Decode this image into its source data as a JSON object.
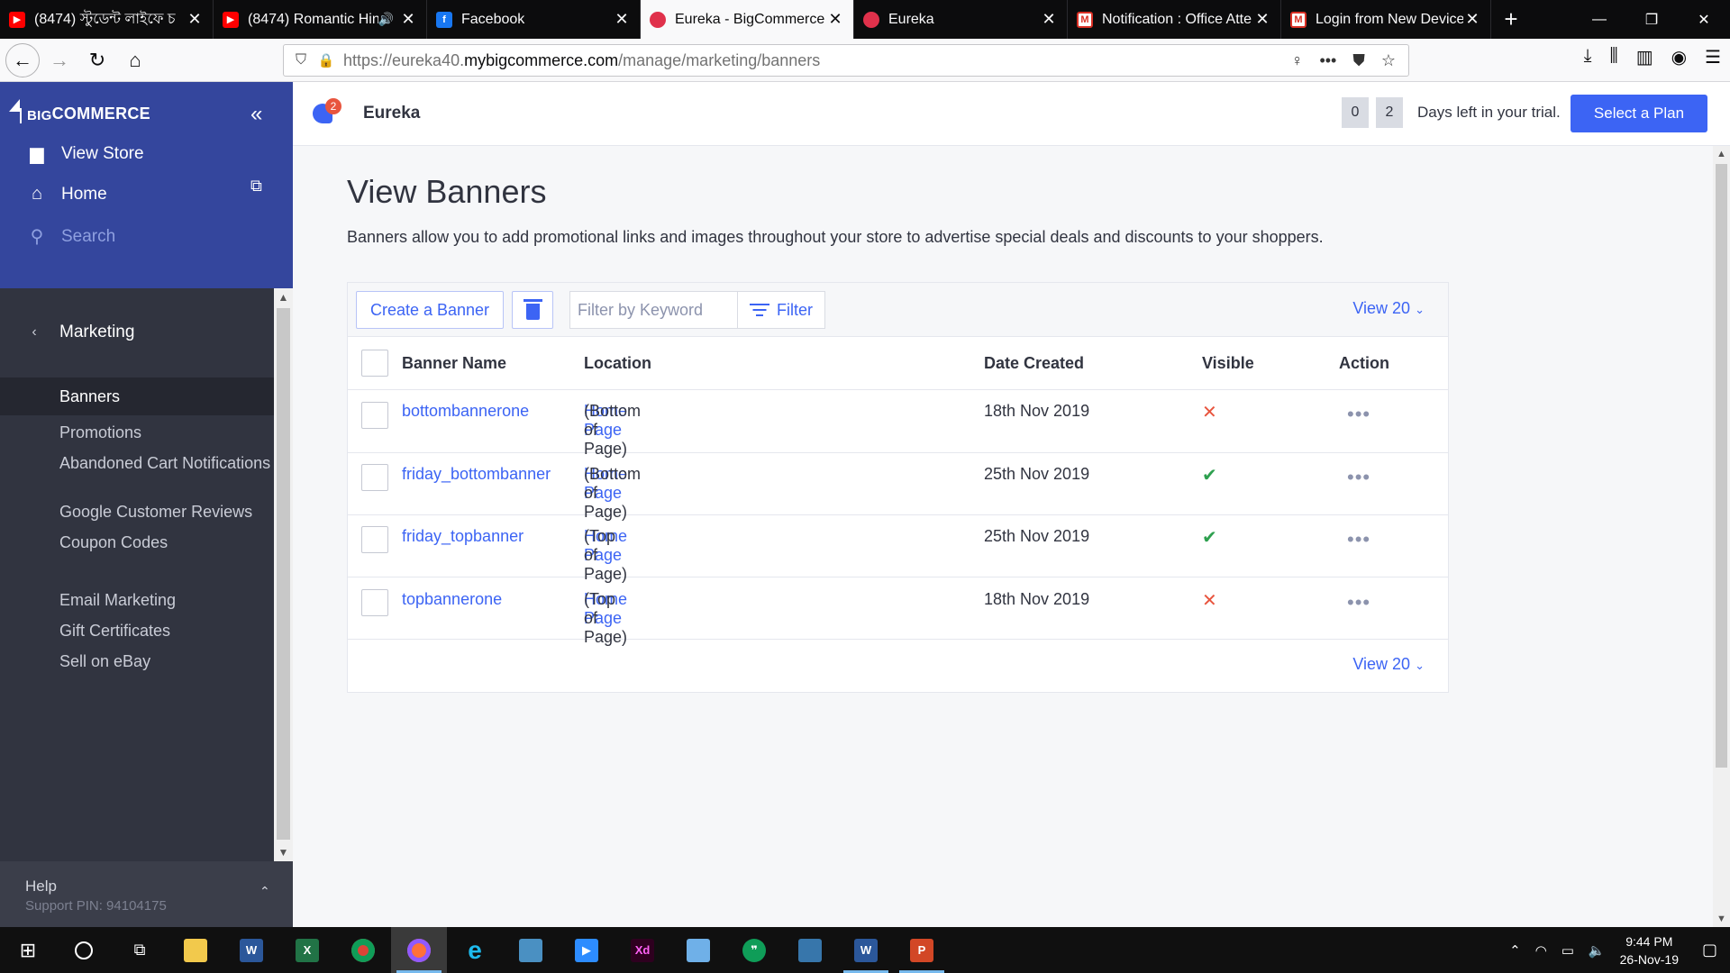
{
  "browser": {
    "tabs": [
      {
        "title": "(8474) স্টুডেন্ট লাইফে চ",
        "favicon": "youtube",
        "active": false
      },
      {
        "title": "(8474) Romantic Hin",
        "favicon": "youtube",
        "active": false
      },
      {
        "title": "Facebook",
        "favicon": "facebook",
        "active": false
      },
      {
        "title": "Eureka - BigCommerce",
        "favicon": "bigcommerce",
        "active": true
      },
      {
        "title": "Eureka",
        "favicon": "bigcommerce",
        "active": false
      },
      {
        "title": "Notification : Office Atte",
        "favicon": "gmail",
        "active": false
      },
      {
        "title": "Login from New Device",
        "favicon": "gmail",
        "active": false
      }
    ],
    "url_prefix": "https://eureka40.",
    "url_domain": "mybigcommerce.com",
    "url_path": "/manage/marketing/banners"
  },
  "sidebar": {
    "brand_a": "BIG",
    "brand_b": "COMMERCE",
    "view_store": "View Store",
    "home": "Home",
    "search": "Search",
    "section": "Marketing",
    "items": [
      {
        "label": "Banners",
        "active": true
      },
      {
        "label": "Promotions"
      },
      {
        "label": "Abandoned Cart Notifications"
      },
      {
        "label": "Google Customer Reviews"
      },
      {
        "label": "Coupon Codes"
      },
      {
        "label": "Email Marketing"
      },
      {
        "label": "Gift Certificates"
      },
      {
        "label": "Sell on eBay"
      }
    ],
    "help": "Help",
    "support_pin": "Support PIN: 94104175"
  },
  "header": {
    "notification_count": "2",
    "store_name": "Eureka",
    "trial_digits": [
      "0",
      "2"
    ],
    "trial_text": "Days left in your trial.",
    "plan_button": "Select a Plan"
  },
  "page": {
    "title": "View Banners",
    "description": "Banners allow you to add promotional links and images throughout your store to advertise special deals and discounts to your shoppers.",
    "create_button": "Create a Banner",
    "filter_placeholder": "Filter by Keyword",
    "filter_button": "Filter",
    "view_count": "View 20"
  },
  "table": {
    "columns": [
      "Banner Name",
      "Location",
      "Date Created",
      "Visible",
      "Action"
    ],
    "rows": [
      {
        "name": "bottombannerone",
        "location_link": "Home Page",
        "location_detail": " (Bottom of Page)",
        "date": "18th Nov 2019",
        "visible": false
      },
      {
        "name": "friday_bottombanner",
        "location_link": "Home Page",
        "location_detail": " (Bottom of Page)",
        "date": "25th Nov 2019",
        "visible": true
      },
      {
        "name": "friday_topbanner",
        "location_link": "Home Page",
        "location_detail": " (Top of Page)",
        "date": "25th Nov 2019",
        "visible": true
      },
      {
        "name": "topbannerone",
        "location_link": "Home Page",
        "location_detail": " (Top of Page)",
        "date": "18th Nov 2019",
        "visible": false
      }
    ]
  },
  "taskbar": {
    "time": "9:44 PM",
    "date": "26-Nov-19"
  },
  "colors": {
    "accent": "#3c64f4",
    "sidebar_top": "#34469d",
    "sidebar": "#313440",
    "error": "#e8553e",
    "success": "#2ea04f"
  }
}
